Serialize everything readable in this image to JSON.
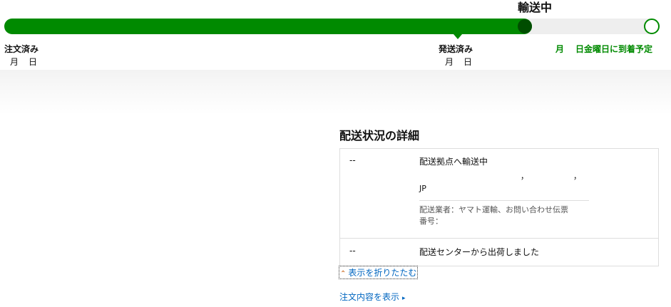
{
  "tracker": {
    "current_status": "輸送中",
    "steps": [
      {
        "title": "注文済み",
        "date": "月　日"
      },
      {
        "title": "発送済み",
        "date": "月　日"
      }
    ],
    "eta_month": "月",
    "eta_text": "日金曜日に到着予定",
    "progress": 0.8,
    "colors": {
      "fill": "#008a00",
      "knob": "#004d00",
      "track": "#eeeeee"
    }
  },
  "details": {
    "heading": "配送状況の詳細",
    "events": [
      {
        "time": "--",
        "description": "配送拠点へ輸送中",
        "location_separators": [
          "，",
          "，"
        ],
        "country": "JP",
        "carrier_note": "配送業者：ヤマト運輸、お問い合わせ伝票",
        "tracking_label": "番号："
      },
      {
        "time": "--",
        "description": "配送センターから出荷しました"
      }
    ],
    "collapse_label": "表示を折りたたむ",
    "collapse_icon": "double-chevron-up-icon"
  },
  "order_link": {
    "label": "注文内容を表示",
    "icon": "chevron-right-icon"
  }
}
